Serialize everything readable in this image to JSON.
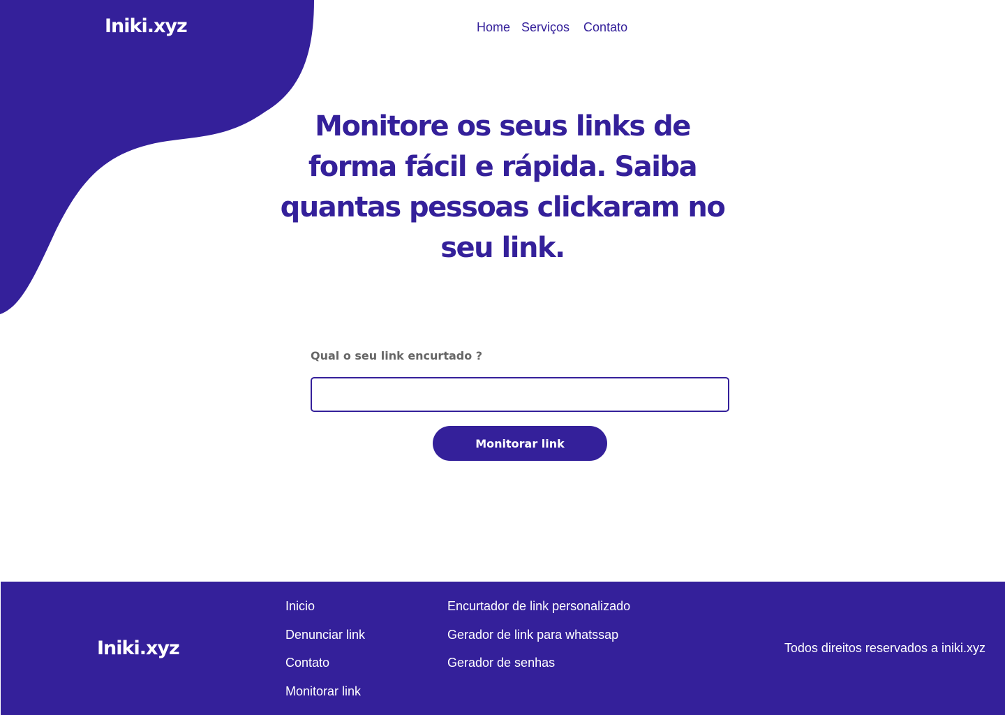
{
  "brand": {
    "logo_text": "Iniki.xyz",
    "primary_color": "#34209a",
    "label_color": "#666666"
  },
  "nav": {
    "items": [
      "Home",
      "Serviços",
      "Contato"
    ]
  },
  "hero": {
    "title": "Monitore os seus links de forma fácil e rápida. Saiba quantas pessoas clickaram no seu link."
  },
  "form": {
    "label": "Qual o seu link encurtado ?",
    "input_value": "",
    "input_placeholder": "",
    "button_label": "Monitorar link"
  },
  "footer": {
    "logo_text": "Iniki.xyz",
    "col1": [
      "Inicio",
      "Denunciar link",
      "Contato",
      "Monitorar link"
    ],
    "col2": [
      "Encurtador de link personalizado",
      "Gerador de link para whatssap",
      "Gerador de senhas"
    ],
    "copyright": "Todos direitos reservados a iniki.xyz"
  }
}
